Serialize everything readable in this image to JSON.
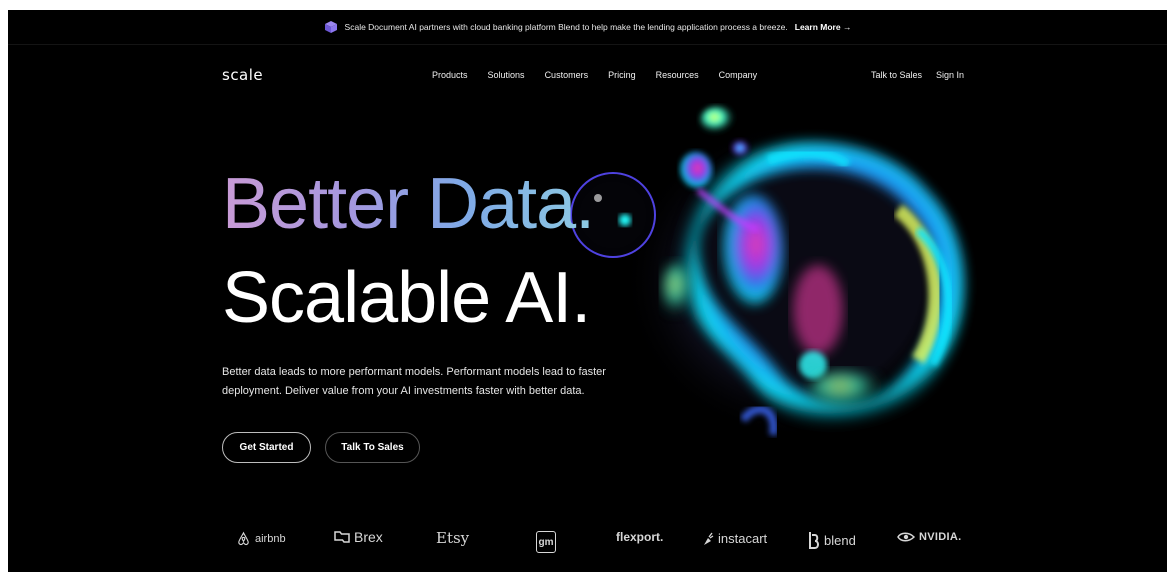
{
  "announcement": {
    "text": "Scale Document AI partners with cloud banking platform Blend to help make the lending application process a breeze.",
    "link": "Learn More →"
  },
  "nav": {
    "logo": "scale",
    "items": [
      {
        "label": "Products"
      },
      {
        "label": "Solutions"
      },
      {
        "label": "Customers"
      },
      {
        "label": "Pricing"
      },
      {
        "label": "Resources"
      },
      {
        "label": "Company"
      }
    ],
    "right": {
      "talk": "Talk to Sales",
      "signin": "Sign In"
    }
  },
  "hero": {
    "line1": "Better Data.",
    "line2": "Scalable AI.",
    "description_1": "Better data leads to more performant models. Performant models lead to faster",
    "description_2": "deployment. Deliver value from your AI investments faster with better data.",
    "cta_primary": "Get Started",
    "cta_secondary": "Talk To Sales"
  },
  "customers": {
    "airbnb": "airbnb",
    "brex": "Brex",
    "etsy": "Etsy",
    "gm": "gm",
    "flexport": "flexport.",
    "instacart": "instacart",
    "blend": "blend",
    "nvidia": "NVIDIA."
  }
}
